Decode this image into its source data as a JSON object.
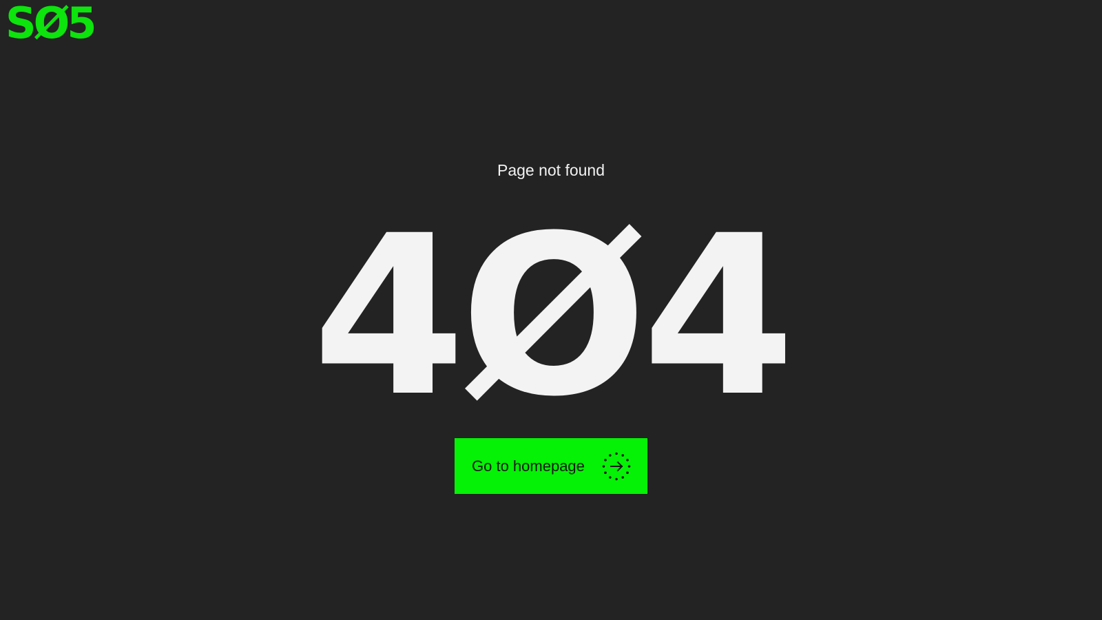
{
  "logo": {
    "text": "SØ5"
  },
  "error": {
    "message": "Page not found",
    "code": "4Ø4"
  },
  "home_button": {
    "label": "Go to homepage",
    "icon": "dotted-circle-arrow-right-icon"
  },
  "colors": {
    "background": "#232323",
    "brand_green": "#0de30d",
    "button_green": "#05f105",
    "text_light": "#f3f3f3",
    "button_text": "#161616"
  }
}
